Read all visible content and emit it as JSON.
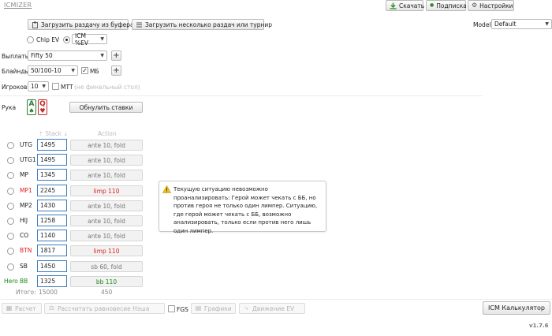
{
  "app": {
    "logo": "ICMIZER",
    "version": "v1.7.6"
  },
  "topbar": {
    "download": "Скачать",
    "subscription": "Подписка",
    "settings": "Настройки"
  },
  "toolbar": {
    "load_clipboard": "Загрузить раздачу из буфера",
    "load_multiple": "Загрузить несколько раздач или турнир",
    "model_label": "Model",
    "model_value": "Default"
  },
  "mode": {
    "chip_ev": "Chip EV",
    "icm_ev": "ICM %EV",
    "selected": "ICM %EV"
  },
  "settings": {
    "payouts_label": "Выплаты",
    "payouts_value": "Fifty 50",
    "blinds_label": "Блайнды",
    "blinds_value": "50/100-10",
    "mb_checked": true,
    "mb_label": "МБ",
    "players_label": "Игроков",
    "players_value": "10",
    "mtt_checked": false,
    "mtt_label": "МТТ",
    "mtt_note": "(не финальный стол)"
  },
  "hand": {
    "label": "Рука",
    "cards": [
      {
        "rank": "A",
        "suit": "♠"
      },
      {
        "rank": "Q",
        "suit": "♥"
      }
    ],
    "reset_bets": "Обнулить ставки"
  },
  "table": {
    "col_stack": "Stack",
    "col_action": "Action",
    "rows": [
      {
        "pos": "UTG",
        "stack": "1495",
        "action": "ante 10, fold",
        "highlight": ""
      },
      {
        "pos": "UTG1",
        "stack": "1495",
        "action": "ante 10, fold",
        "highlight": ""
      },
      {
        "pos": "MP",
        "stack": "1345",
        "action": "ante 10, fold",
        "highlight": ""
      },
      {
        "pos": "MP1",
        "stack": "2245",
        "action": "limp 110",
        "highlight": "red"
      },
      {
        "pos": "MP2",
        "stack": "1430",
        "action": "ante 10, fold",
        "highlight": ""
      },
      {
        "pos": "HIJ",
        "stack": "1258",
        "action": "ante 10, fold",
        "highlight": ""
      },
      {
        "pos": "CO",
        "stack": "1140",
        "action": "ante 10, fold",
        "highlight": ""
      },
      {
        "pos": "BTN",
        "stack": "1817",
        "action": "limp 110",
        "highlight": "red"
      },
      {
        "pos": "SB",
        "stack": "1450",
        "action": "sb 60, fold",
        "highlight": ""
      },
      {
        "pos": "BB",
        "stack": "1325",
        "action": "bb 110",
        "highlight": "green",
        "hero": "Hero"
      }
    ],
    "total_label": "Итого:",
    "total_stack": "15000",
    "total_action": "450"
  },
  "warning": {
    "text": "Текущую ситуацию невозможно проанализировать: Герой может чекать с ББ, но против героя не только один лимпер. Ситуацию, где герой может чекать с ББ, возможно анализировать, только если против него лишь один лимпер."
  },
  "bottombar": {
    "calc": "Расчет",
    "nash": "Рассчитать равновесие Нэша",
    "fgs_label": "FGS",
    "charts": "Графики",
    "ev_flow": "Движение EV",
    "icm_calc": "ICM Калькулятор"
  },
  "colors": {
    "accent_blue": "#3b7dc0",
    "red": "#e02020",
    "green": "#1a8a1a",
    "download_green": "#2e8b2e"
  }
}
